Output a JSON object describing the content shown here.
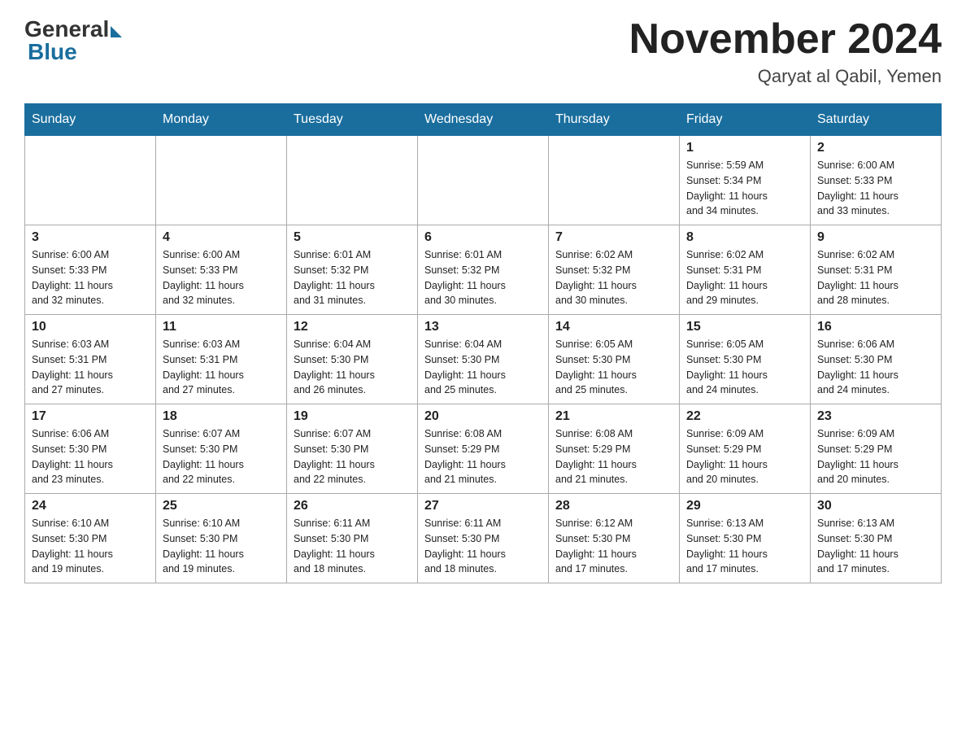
{
  "header": {
    "logo": {
      "general": "General",
      "blue": "Blue"
    },
    "title": "November 2024",
    "location": "Qaryat al Qabil, Yemen"
  },
  "weekdays": [
    "Sunday",
    "Monday",
    "Tuesday",
    "Wednesday",
    "Thursday",
    "Friday",
    "Saturday"
  ],
  "weeks": [
    [
      {
        "day": "",
        "info": ""
      },
      {
        "day": "",
        "info": ""
      },
      {
        "day": "",
        "info": ""
      },
      {
        "day": "",
        "info": ""
      },
      {
        "day": "",
        "info": ""
      },
      {
        "day": "1",
        "info": "Sunrise: 5:59 AM\nSunset: 5:34 PM\nDaylight: 11 hours\nand 34 minutes."
      },
      {
        "day": "2",
        "info": "Sunrise: 6:00 AM\nSunset: 5:33 PM\nDaylight: 11 hours\nand 33 minutes."
      }
    ],
    [
      {
        "day": "3",
        "info": "Sunrise: 6:00 AM\nSunset: 5:33 PM\nDaylight: 11 hours\nand 32 minutes."
      },
      {
        "day": "4",
        "info": "Sunrise: 6:00 AM\nSunset: 5:33 PM\nDaylight: 11 hours\nand 32 minutes."
      },
      {
        "day": "5",
        "info": "Sunrise: 6:01 AM\nSunset: 5:32 PM\nDaylight: 11 hours\nand 31 minutes."
      },
      {
        "day": "6",
        "info": "Sunrise: 6:01 AM\nSunset: 5:32 PM\nDaylight: 11 hours\nand 30 minutes."
      },
      {
        "day": "7",
        "info": "Sunrise: 6:02 AM\nSunset: 5:32 PM\nDaylight: 11 hours\nand 30 minutes."
      },
      {
        "day": "8",
        "info": "Sunrise: 6:02 AM\nSunset: 5:31 PM\nDaylight: 11 hours\nand 29 minutes."
      },
      {
        "day": "9",
        "info": "Sunrise: 6:02 AM\nSunset: 5:31 PM\nDaylight: 11 hours\nand 28 minutes."
      }
    ],
    [
      {
        "day": "10",
        "info": "Sunrise: 6:03 AM\nSunset: 5:31 PM\nDaylight: 11 hours\nand 27 minutes."
      },
      {
        "day": "11",
        "info": "Sunrise: 6:03 AM\nSunset: 5:31 PM\nDaylight: 11 hours\nand 27 minutes."
      },
      {
        "day": "12",
        "info": "Sunrise: 6:04 AM\nSunset: 5:30 PM\nDaylight: 11 hours\nand 26 minutes."
      },
      {
        "day": "13",
        "info": "Sunrise: 6:04 AM\nSunset: 5:30 PM\nDaylight: 11 hours\nand 25 minutes."
      },
      {
        "day": "14",
        "info": "Sunrise: 6:05 AM\nSunset: 5:30 PM\nDaylight: 11 hours\nand 25 minutes."
      },
      {
        "day": "15",
        "info": "Sunrise: 6:05 AM\nSunset: 5:30 PM\nDaylight: 11 hours\nand 24 minutes."
      },
      {
        "day": "16",
        "info": "Sunrise: 6:06 AM\nSunset: 5:30 PM\nDaylight: 11 hours\nand 24 minutes."
      }
    ],
    [
      {
        "day": "17",
        "info": "Sunrise: 6:06 AM\nSunset: 5:30 PM\nDaylight: 11 hours\nand 23 minutes."
      },
      {
        "day": "18",
        "info": "Sunrise: 6:07 AM\nSunset: 5:30 PM\nDaylight: 11 hours\nand 22 minutes."
      },
      {
        "day": "19",
        "info": "Sunrise: 6:07 AM\nSunset: 5:30 PM\nDaylight: 11 hours\nand 22 minutes."
      },
      {
        "day": "20",
        "info": "Sunrise: 6:08 AM\nSunset: 5:29 PM\nDaylight: 11 hours\nand 21 minutes."
      },
      {
        "day": "21",
        "info": "Sunrise: 6:08 AM\nSunset: 5:29 PM\nDaylight: 11 hours\nand 21 minutes."
      },
      {
        "day": "22",
        "info": "Sunrise: 6:09 AM\nSunset: 5:29 PM\nDaylight: 11 hours\nand 20 minutes."
      },
      {
        "day": "23",
        "info": "Sunrise: 6:09 AM\nSunset: 5:29 PM\nDaylight: 11 hours\nand 20 minutes."
      }
    ],
    [
      {
        "day": "24",
        "info": "Sunrise: 6:10 AM\nSunset: 5:30 PM\nDaylight: 11 hours\nand 19 minutes."
      },
      {
        "day": "25",
        "info": "Sunrise: 6:10 AM\nSunset: 5:30 PM\nDaylight: 11 hours\nand 19 minutes."
      },
      {
        "day": "26",
        "info": "Sunrise: 6:11 AM\nSunset: 5:30 PM\nDaylight: 11 hours\nand 18 minutes."
      },
      {
        "day": "27",
        "info": "Sunrise: 6:11 AM\nSunset: 5:30 PM\nDaylight: 11 hours\nand 18 minutes."
      },
      {
        "day": "28",
        "info": "Sunrise: 6:12 AM\nSunset: 5:30 PM\nDaylight: 11 hours\nand 17 minutes."
      },
      {
        "day": "29",
        "info": "Sunrise: 6:13 AM\nSunset: 5:30 PM\nDaylight: 11 hours\nand 17 minutes."
      },
      {
        "day": "30",
        "info": "Sunrise: 6:13 AM\nSunset: 5:30 PM\nDaylight: 11 hours\nand 17 minutes."
      }
    ]
  ]
}
